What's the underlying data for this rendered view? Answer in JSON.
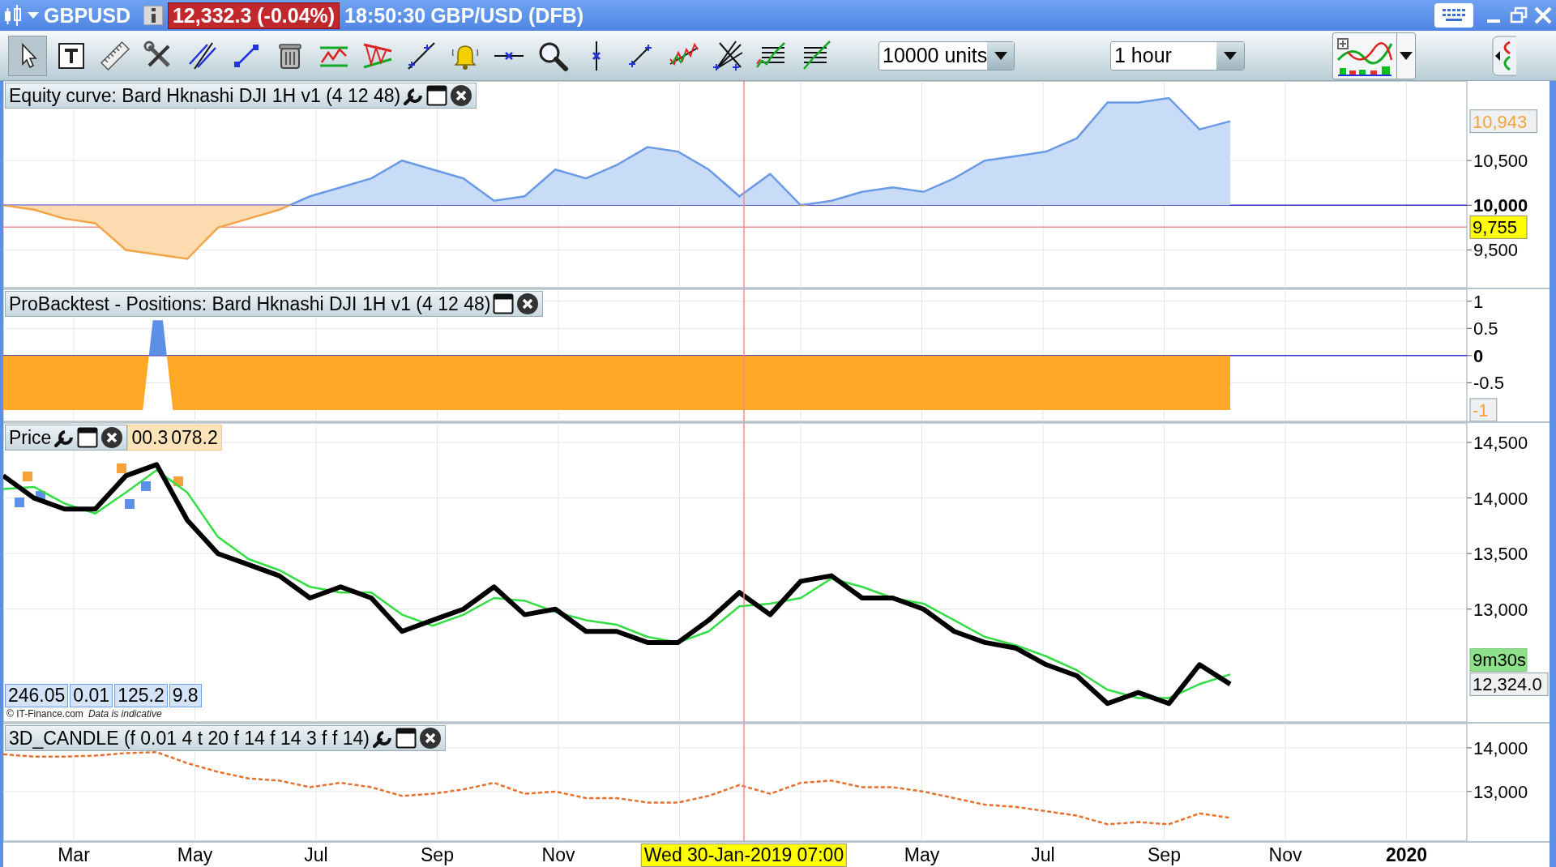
{
  "title_bar": {
    "symbol": "GBPUSD",
    "quote": "12,332.3 (-0.04%)",
    "time": "18:50:30",
    "instrument": "GBP/USD (DFB)"
  },
  "toolbar": {
    "tools": [
      {
        "kind": "pointer",
        "selected": true
      },
      {
        "kind": "text",
        "selected": false
      },
      {
        "kind": "ruler",
        "selected": false
      },
      {
        "kind": "tools",
        "selected": false
      },
      {
        "kind": "parallel",
        "selected": false
      },
      {
        "kind": "segment",
        "selected": false
      },
      {
        "kind": "trash",
        "selected": false
      },
      {
        "kind": "channel",
        "selected": false
      },
      {
        "kind": "triangle",
        "selected": false
      },
      {
        "kind": "line",
        "selected": false
      },
      {
        "kind": "alert",
        "selected": false
      },
      {
        "kind": "hline",
        "selected": false
      },
      {
        "kind": "zoom",
        "selected": false
      },
      {
        "kind": "vline",
        "selected": false
      },
      {
        "kind": "ray",
        "selected": false
      },
      {
        "kind": "zigzag",
        "selected": false
      },
      {
        "kind": "fan",
        "selected": false
      },
      {
        "kind": "fib",
        "selected": false
      },
      {
        "kind": "fibfan",
        "selected": false
      }
    ],
    "size": {
      "value": "10000 units"
    },
    "timeframe": {
      "value": "1 hour"
    }
  },
  "panels": [
    {
      "kind": "equity",
      "title": "Equity curve: Bard Hknashi DJI 1H v1 (4 12 48)",
      "settings": true,
      "value_labels": [
        {
          "kind": "last"
        }
      ],
      "chart_data": {
        "type": "area",
        "grid": true,
        "ylim": [
          9060,
          11390
        ],
        "yticks": [
          {
            "value": 10500,
            "label": "10,500"
          },
          {
            "value": 10000,
            "label": "10,000"
          },
          {
            "value": 9500,
            "label": "9,500"
          }
        ],
        "series": [
          {
            "color": "#6a9ae6",
            "values": [
              10000,
              9950,
              9850,
              9800,
              9500,
              9450,
              9400,
              9750,
              9850,
              9950,
              10100,
              10200,
              10300,
              10500,
              10400,
              10300,
              10050,
              10100,
              10400,
              10300,
              10450,
              10650,
              10600,
              10400,
              10100,
              10350,
              10000,
              10050,
              10150,
              10200,
              10150,
              10300,
              10500,
              10550,
              10600,
              10750,
              11150,
              11150,
              11200,
              10850,
              10940
            ]
          }
        ],
        "ref_lines": [
          {
            "axis": "y",
            "value": 10000,
            "color": "#3333cc"
          },
          {
            "axis": "y",
            "value": 9755,
            "color": "#f08c8c",
            "label": "9,755"
          }
        ],
        "annotations": [
          "10,943"
        ]
      }
    },
    {
      "kind": "positions",
      "title": "ProBacktest - Positions: Bard Hknashi DJI 1H v1 (4 12 48)",
      "settings": false,
      "value_labels": [
        {
          "kind": "last"
        }
      ],
      "chart_data": {
        "type": "area",
        "grid": true,
        "ylim": [
          -1.24,
          1.22
        ],
        "yticks": [
          {
            "value": 1,
            "label": "1"
          },
          {
            "value": 0.5,
            "label": "0.5"
          },
          {
            "value": 0,
            "label": "0"
          },
          {
            "value": -0.5,
            "label": "-0.5"
          }
        ],
        "series": [
          {
            "color": "#ffa726",
            "values": [
              -1,
              -1,
              -1,
              -1,
              -1,
              -1,
              -1,
              -1,
              -1,
              -1,
              -1,
              -1,
              -1,
              -1,
              -1,
              0.65,
              0.65,
              -1,
              -1,
              -1,
              -1,
              -1,
              -1,
              -1,
              -1,
              -1,
              -1,
              -1,
              -1,
              -1,
              -1,
              -1,
              -1,
              -1,
              -1,
              -1,
              -1,
              -1,
              -1,
              -1,
              -1,
              -1,
              -1,
              -1,
              -1,
              -1,
              -1,
              -1,
              -1,
              -1,
              -1,
              -1,
              -1,
              -1,
              -1,
              -1,
              -1,
              -1,
              -1,
              -1,
              -1,
              -1,
              -1,
              -1,
              -1,
              -1,
              -1,
              -1,
              -1,
              -1,
              -1,
              -1,
              -1,
              -1,
              -1,
              -1,
              -1,
              -1,
              -1,
              -1,
              -1,
              -1,
              -1,
              -1,
              -1,
              -1,
              -1,
              -1,
              -1,
              -1,
              -1,
              -1,
              -1,
              -1,
              -1,
              -1,
              -1,
              -1,
              -1,
              -1,
              -1,
              -1,
              -1,
              -1,
              -1,
              -1,
              -1,
              -1,
              -1,
              -1,
              -1,
              -1,
              -1,
              -1,
              -1,
              -1,
              -1,
              -1,
              -1,
              -1,
              -1,
              -1,
              -1,
              -1
            ]
          }
        ],
        "ref_lines": [
          {
            "axis": "y",
            "value": 0,
            "color": "#3333cc"
          }
        ],
        "annotations": [
          "-1"
        ]
      }
    },
    {
      "kind": "price",
      "title": "Price",
      "settings": true,
      "header_values": [
        "00.3",
        "078.2"
      ],
      "footer_values": [
        "246.05",
        "0.01",
        "125.2",
        "9.8"
      ],
      "credit": "© IT-Finance.com",
      "disclaimer": "Data is indicative",
      "value_labels": [
        {
          "kind": "countdown"
        },
        {
          "kind": "price"
        }
      ],
      "chart_data": {
        "type": "line",
        "grid": true,
        "ylim": [
          11970,
          14675
        ],
        "yticks": [
          {
            "value": 14500,
            "label": "14,500"
          },
          {
            "value": 14000,
            "label": "14,000"
          },
          {
            "value": 13500,
            "label": "13,500"
          },
          {
            "value": 13000,
            "label": "13,000"
          }
        ],
        "series": [
          {
            "color": "#000000",
            "values": [
              14200,
              14000,
              13900,
              13900,
              14200,
              14300,
              13800,
              13500,
              13400,
              13300,
              13100,
              13200,
              13100,
              12800,
              12900,
              13000,
              13200,
              12950,
              13000,
              12800,
              12800,
              12700,
              12700,
              12900,
              13150,
              12950,
              13250,
              13300,
              13100,
              13100,
              13000,
              12800,
              12700,
              12650,
              12500,
              12400,
              12150,
              12250,
              12150,
              12500,
              12324
            ]
          },
          {
            "color": "#33dd44",
            "values": [
              14080,
              14100,
              13950,
              13860,
              14050,
              14250,
              14050,
              13650,
              13450,
              13350,
              13200,
              13150,
              13150,
              12950,
              12850,
              12950,
              13100,
              13075,
              12975,
              12900,
              12860,
              12750,
              12700,
              12800,
              13025,
              13050,
              13100,
              13275,
              13200,
              13100,
              13050,
              12900,
              12750,
              12675,
              12575,
              12450,
              12275,
              12200,
              12200,
              12325,
              12412
            ]
          }
        ],
        "annotations": [
          "9m30s",
          "12,324.0"
        ]
      }
    },
    {
      "kind": "indicator",
      "title": "3D_CANDLE (f 0.01 4 t 20 f 14 f 14 3 f f 14)",
      "settings": true,
      "chart_data": {
        "type": "line",
        "grid": true,
        "ylim": [
          11830,
          14555
        ],
        "yticks": [
          {
            "value": 14000,
            "label": "14,000"
          },
          {
            "value": 13000,
            "label": "13,000"
          }
        ],
        "series": [
          {
            "color": "#e8702a",
            "line_style": "dashed",
            "values": [
              13850,
              13800,
              13800,
              13820,
              13880,
              13900,
              13650,
              13450,
              13300,
              13250,
              13100,
              13200,
              13100,
              12900,
              12950,
              13050,
              13200,
              12950,
              13000,
              12850,
              12850,
              12750,
              12750,
              12900,
              13150,
              12950,
              13200,
              13250,
              13100,
              13100,
              13000,
              12850,
              12700,
              12650,
              12550,
              12450,
              12250,
              12300,
              12250,
              12500,
              12400
            ]
          }
        ]
      }
    }
  ],
  "x_axis": {
    "labels": [
      {
        "text": "Mar",
        "kind": "month"
      },
      {
        "text": "May",
        "kind": "month"
      },
      {
        "text": "Jul",
        "kind": "month"
      },
      {
        "text": "Sep",
        "kind": "month"
      },
      {
        "text": "Nov",
        "kind": "month"
      },
      {
        "text": "May",
        "kind": "month"
      },
      {
        "text": "Jul",
        "kind": "month"
      },
      {
        "text": "Sep",
        "kind": "month"
      },
      {
        "text": "Nov",
        "kind": "month"
      },
      {
        "text": "2020",
        "kind": "year"
      }
    ],
    "cursor_label": "Wed 30-Jan-2019 07:00"
  }
}
